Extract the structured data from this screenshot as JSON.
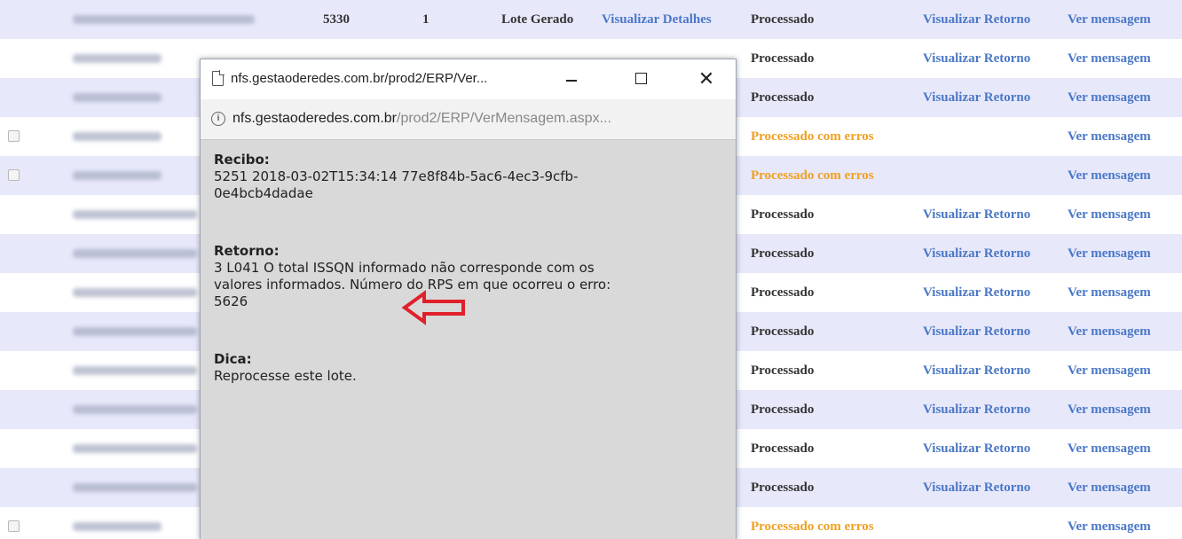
{
  "table": {
    "rows": [
      {
        "shade": true,
        "checkbox": false,
        "left_blur": true,
        "numero": "5330",
        "qtd": "1",
        "situacao": "Lote Gerado",
        "detalhes": "Visualizar Detalhes",
        "status": "Processado",
        "status_error": false,
        "retorno": "Visualizar Retorno",
        "mensagem": "Ver mensagem"
      },
      {
        "shade": false,
        "checkbox": false,
        "left_blur": true,
        "numero": "",
        "qtd": "",
        "situacao": "",
        "detalhes": "",
        "status": "Processado",
        "status_error": false,
        "retorno": "Visualizar Retorno",
        "mensagem": "Ver mensagem"
      },
      {
        "shade": true,
        "checkbox": false,
        "left_blur": true,
        "numero": "",
        "qtd": "",
        "situacao": "",
        "detalhes": "",
        "status": "Processado",
        "status_error": false,
        "retorno": "Visualizar Retorno",
        "mensagem": "Ver mensagem"
      },
      {
        "shade": false,
        "checkbox": true,
        "left_blur": true,
        "numero": "",
        "qtd": "",
        "situacao": "",
        "detalhes": "",
        "status": "Processado com erros",
        "status_error": true,
        "retorno": "",
        "mensagem": "Ver mensagem"
      },
      {
        "shade": true,
        "checkbox": true,
        "left_blur": true,
        "numero": "",
        "qtd": "",
        "situacao": "",
        "detalhes": "",
        "status": "Processado com erros",
        "status_error": true,
        "retorno": "",
        "mensagem": "Ver mensagem"
      },
      {
        "shade": false,
        "checkbox": false,
        "left_blur": true,
        "numero": "",
        "qtd": "",
        "situacao": "",
        "detalhes": "",
        "status": "Processado",
        "status_error": false,
        "retorno": "Visualizar Retorno",
        "mensagem": "Ver mensagem"
      },
      {
        "shade": true,
        "checkbox": false,
        "left_blur": true,
        "numero": "",
        "qtd": "",
        "situacao": "",
        "detalhes": "",
        "status": "Processado",
        "status_error": false,
        "retorno": "Visualizar Retorno",
        "mensagem": "Ver mensagem"
      },
      {
        "shade": false,
        "checkbox": false,
        "left_blur": true,
        "numero": "",
        "qtd": "",
        "situacao": "",
        "detalhes": "",
        "status": "Processado",
        "status_error": false,
        "retorno": "Visualizar Retorno",
        "mensagem": "Ver mensagem"
      },
      {
        "shade": true,
        "checkbox": false,
        "left_blur": true,
        "numero": "",
        "qtd": "",
        "situacao": "",
        "detalhes": "",
        "status": "Processado",
        "status_error": false,
        "retorno": "Visualizar Retorno",
        "mensagem": "Ver mensagem"
      },
      {
        "shade": false,
        "checkbox": false,
        "left_blur": true,
        "numero": "",
        "qtd": "",
        "situacao": "",
        "detalhes": "",
        "status": "Processado",
        "status_error": false,
        "retorno": "Visualizar Retorno",
        "mensagem": "Ver mensagem"
      },
      {
        "shade": true,
        "checkbox": false,
        "left_blur": true,
        "numero": "",
        "qtd": "",
        "situacao": "",
        "detalhes": "",
        "status": "Processado",
        "status_error": false,
        "retorno": "Visualizar Retorno",
        "mensagem": "Ver mensagem"
      },
      {
        "shade": false,
        "checkbox": false,
        "left_blur": true,
        "numero": "",
        "qtd": "",
        "situacao": "",
        "detalhes": "",
        "status": "Processado",
        "status_error": false,
        "retorno": "Visualizar Retorno",
        "mensagem": "Ver mensagem"
      },
      {
        "shade": true,
        "checkbox": false,
        "left_blur": true,
        "numero": "",
        "qtd": "",
        "situacao": "",
        "detalhes": "",
        "status": "Processado",
        "status_error": false,
        "retorno": "Visualizar Retorno",
        "mensagem": "Ver mensagem"
      },
      {
        "shade": false,
        "checkbox": true,
        "left_blur": true,
        "numero": "",
        "qtd": "",
        "situacao": "",
        "detalhes": "",
        "status": "Processado com erros",
        "status_error": true,
        "retorno": "",
        "mensagem": "Ver mensagem"
      }
    ]
  },
  "popup": {
    "title": "nfs.gestaoderedes.com.br/prod2/ERP/Ver...",
    "url_host": "nfs.gestaoderedes.com.br",
    "url_path": "/prod2/ERP/VerMensagem.aspx...",
    "recibo_label": "Recibo:",
    "recibo_line1": "5251 2018-03-02T15:34:14 77e8f84b-5ac6-4ec3-9cfb-",
    "recibo_line2": "0e4bcb4dadae",
    "retorno_label": "Retorno:",
    "retorno_line1": "3 L041 O total ISSQN informado não corresponde com os",
    "retorno_line2": "valores informados. Número do RPS em que ocorreu o erro:",
    "retorno_line3": "5626",
    "dica_label": "Dica:",
    "dica_text": "Reprocesse este lote.",
    "annotation_color": "#e0202a",
    "icons": {
      "page": "page-icon",
      "info": "info-icon",
      "minimize": "minimize-icon",
      "maximize": "maximize-icon",
      "close": "close-icon",
      "arrow": "arrow-left-icon"
    }
  }
}
